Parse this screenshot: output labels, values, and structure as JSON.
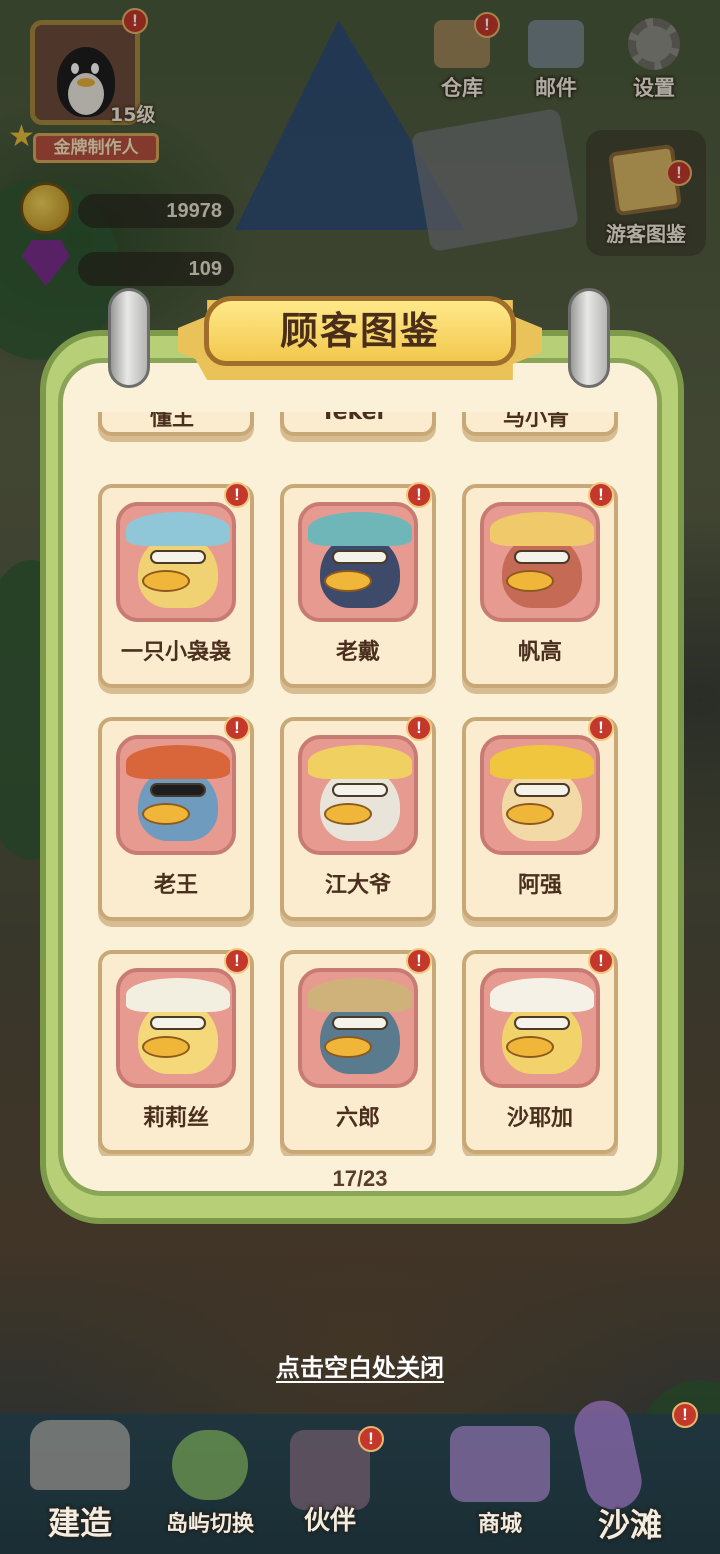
{
  "hud": {
    "level": "15级",
    "rank": "金牌制作人",
    "coins": "19978",
    "gems": "109",
    "top_buttons": [
      {
        "label": "仓库",
        "icon": "warehouse-icon"
      },
      {
        "label": "邮件",
        "icon": "mail-icon"
      },
      {
        "label": "设置",
        "icon": "gear-icon"
      }
    ],
    "side_button": {
      "label": "游客图鉴",
      "icon": "visitor-album-icon"
    },
    "alert_glyph": "!"
  },
  "modal": {
    "title": "顾客图鉴",
    "partial_row": [
      "懂王",
      "Teker",
      "马小青"
    ],
    "customers": [
      {
        "name": "一只小袅袅",
        "alert": true,
        "hat": "#8fc6d8",
        "head": "#f1d272"
      },
      {
        "name": "老戴",
        "alert": true,
        "hat": "#6fb6b8",
        "head": "#3e4a6a"
      },
      {
        "name": "帆高",
        "alert": true,
        "hat": "#efc96a",
        "head": "#c46a55"
      },
      {
        "name": "老王",
        "alert": true,
        "hat": "#d9663a",
        "head": "#6f9bbf"
      },
      {
        "name": "江大爷",
        "alert": true,
        "hat": "#f1d062",
        "head": "#e8e4da"
      },
      {
        "name": "阿强",
        "alert": true,
        "hat": "#f0c63e",
        "head": "#f2d9a6"
      },
      {
        "name": "莉莉丝",
        "alert": true,
        "hat": "#f2efe0",
        "head": "#f4d87a"
      },
      {
        "name": "六郎",
        "alert": true,
        "hat": "#cfb27a",
        "head": "#5a7a8e"
      },
      {
        "name": "沙耶加",
        "alert": true,
        "hat": "#f6f1e6",
        "head": "#f2d26a"
      }
    ],
    "page_counter": "17/23"
  },
  "close_hint": "点击空白处关闭",
  "bottom_nav": [
    {
      "label": "建造",
      "icon": "build-hammer-icon"
    },
    {
      "label": "岛屿切换",
      "icon": "island-switch-icon"
    },
    {
      "label": "伙伴",
      "icon": "partner-icon"
    },
    {
      "label": "商城",
      "icon": "shop-icon"
    },
    {
      "label": "沙滩",
      "icon": "beach-surfboard-icon"
    }
  ]
}
